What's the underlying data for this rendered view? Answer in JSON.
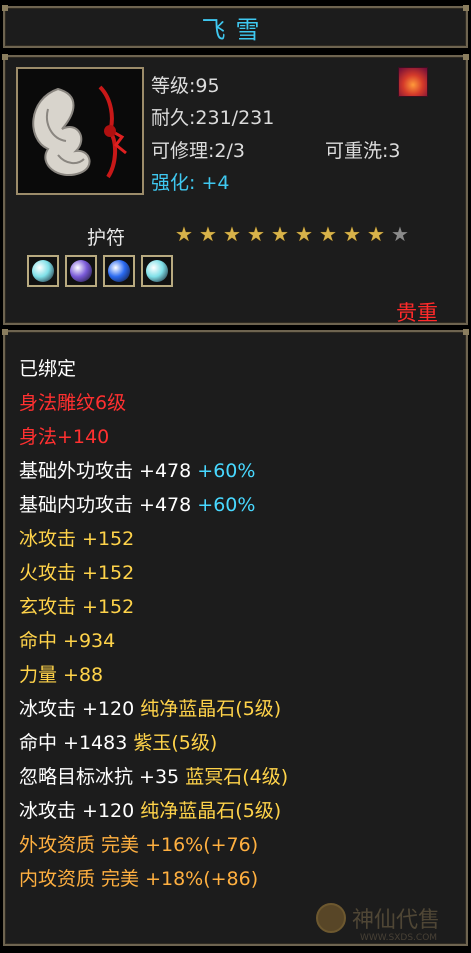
{
  "item": {
    "name": "飞雪",
    "level_label": "等级:",
    "level_value": "95",
    "durability_label": "耐久:",
    "durability_value": "231/231",
    "repair_label": "可修理:",
    "repair_value": "2/3",
    "rewash_label": "可重洗:",
    "rewash_value": "3",
    "enhance_label": "强化:",
    "enhance_value": "+4",
    "school_icon": "fire-school-icon",
    "amulet_label": "护符",
    "stars_filled": 9,
    "stars_total": 10,
    "gems": [
      {
        "icon": "cyan-gem-icon",
        "color": "#7fe0e8"
      },
      {
        "icon": "purple-gem-icon",
        "color": "#7a5ad8"
      },
      {
        "icon": "blue-gem-icon",
        "color": "#2a6af0"
      },
      {
        "icon": "cyan-gem-icon",
        "color": "#7fe0e8"
      }
    ],
    "rarity": "贵重"
  },
  "properties": [
    {
      "text": "已绑定",
      "color": "white"
    },
    {
      "text": "身法雕纹6级",
      "color": "red"
    },
    {
      "text": "身法+140",
      "color": "red"
    },
    {
      "text": "基础外功攻击 +478",
      "color": "white",
      "extra": "+60%",
      "extra_color": "cyan"
    },
    {
      "text": "基础内功攻击 +478",
      "color": "white",
      "extra": "+60%",
      "extra_color": "cyan"
    },
    {
      "text": "冰攻击 +152",
      "color": "yellow"
    },
    {
      "text": "火攻击 +152",
      "color": "yellow"
    },
    {
      "text": "玄攻击 +152",
      "color": "yellow"
    },
    {
      "text": "命中 +934",
      "color": "yellow"
    },
    {
      "text": "力量 +88",
      "color": "yellow"
    },
    {
      "text": "冰攻击 +120",
      "color": "white",
      "extra": "纯净蓝晶石(5级)",
      "extra_color": "yellow"
    },
    {
      "text": "命中 +1483",
      "color": "white",
      "extra": "紫玉(5级)",
      "extra_color": "yellow"
    },
    {
      "text": "忽略目标冰抗 +35",
      "color": "white",
      "extra": "蓝冥石(4级)",
      "extra_color": "yellow"
    },
    {
      "text": "冰攻击 +120",
      "color": "white",
      "extra": "纯净蓝晶石(5级)",
      "extra_color": "yellow"
    },
    {
      "text": "外攻资质  完美 +16%(+76)",
      "color": "orange"
    },
    {
      "text": "内攻资质  完美 +18%(+86)",
      "color": "orange"
    }
  ],
  "watermark": {
    "text": "神仙代售",
    "url": "WWW.SXDS.COM"
  },
  "colors": {
    "title": "#3fc8f0",
    "rarity": "#ff2a2a",
    "frame": "#6e6450"
  }
}
